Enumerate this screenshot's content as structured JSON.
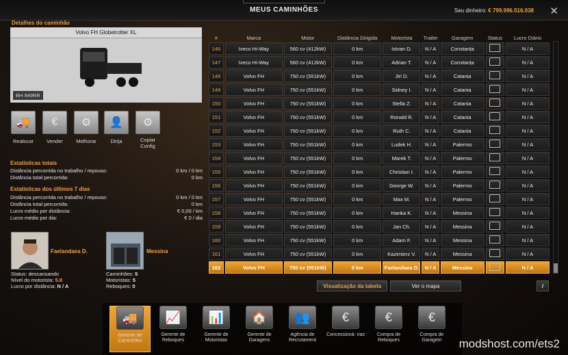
{
  "header": {
    "title": "MEUS CAMINHÕES",
    "money_label": "Seu dinheiro:",
    "money_value": "€ 799.996.516.038",
    "close": "✕"
  },
  "truck": {
    "section_title": "Detalhes do caminhão",
    "name": "Volvo FH Globetrotter XL",
    "plate": "BH 949RR"
  },
  "actions": [
    {
      "label": "Realocar",
      "icon": "truck-relocate-icon"
    },
    {
      "label": "Vender",
      "icon": "sell-truck-icon"
    },
    {
      "label": "Melhorar",
      "icon": "upgrade-truck-icon"
    },
    {
      "label": "Dirija",
      "icon": "drive-icon"
    },
    {
      "label": "Copiar",
      "label2": "Config",
      "icon": "copy-config-icon"
    }
  ],
  "stats_total": {
    "title": "Estatísticas totais",
    "rows": [
      {
        "label": "Distância percorrida no trabalho / repouso:",
        "value": "0 km / 0 km"
      },
      {
        "label": "Distância total percorrida:",
        "value": "0 km"
      }
    ]
  },
  "stats_7days": {
    "title": "Estatísticas dos últimos 7 dias",
    "rows": [
      {
        "label": "Distância percorrida no trabalho / repouso:",
        "value": "0 km / 0 km"
      },
      {
        "label": "Distância total percorrida:",
        "value": "0 km"
      },
      {
        "label": "Lucro médio por distância:",
        "value": "€ 0,00 / km"
      },
      {
        "label": "Lucro médio por dia:",
        "value": "€ 0 / dia"
      }
    ]
  },
  "driver": {
    "name": "Faelandaea D.",
    "status_label": "Status:",
    "status": "descansando",
    "level_label": "Nível do motorista:",
    "level": "5.8",
    "profit_label": "Lucro por distância:",
    "profit": "N / A"
  },
  "garage": {
    "name": "Messina",
    "trucks_label": "Caminhões:",
    "trucks": "5",
    "drivers_label": "Motoristas:",
    "drivers": "5",
    "trailers_label": "Reboques:",
    "trailers": "0"
  },
  "table": {
    "headers": [
      "#",
      "Marca",
      "Motor",
      "Distância Dirigida",
      "Motorista",
      "Trailer",
      "Garagem",
      "Status",
      "Lucro Diário"
    ],
    "rows": [
      [
        "146",
        "Iveco Hi-Way",
        "560 cv (412kW)",
        "0 km",
        "Istvan D.",
        "N / A",
        "Constanța",
        "N / A"
      ],
      [
        "147",
        "Iveco Hi-Way",
        "560 cv (412kW)",
        "0 km",
        "Adrian T.",
        "N / A",
        "Constanța",
        "N / A"
      ],
      [
        "148",
        "Volvo FH",
        "750 cv (551kW)",
        "0 km",
        "Jiri D.",
        "N / A",
        "Catania",
        "N / A"
      ],
      [
        "149",
        "Volvo FH",
        "750 cv (551kW)",
        "0 km",
        "Sidney I.",
        "N / A",
        "Catania",
        "N / A"
      ],
      [
        "150",
        "Volvo FH",
        "750 cv (551kW)",
        "0 km",
        "Stella Z.",
        "N / A",
        "Catania",
        "N / A"
      ],
      [
        "151",
        "Volvo FH",
        "750 cv (551kW)",
        "0 km",
        "Ronald R.",
        "N / A",
        "Catania",
        "N / A"
      ],
      [
        "152",
        "Volvo FH",
        "750 cv (551kW)",
        "0 km",
        "Ruth C.",
        "N / A",
        "Catania",
        "N / A"
      ],
      [
        "153",
        "Volvo FH",
        "750 cv (551kW)",
        "0 km",
        "Ludek H.",
        "N / A",
        "Palermo",
        "N / A"
      ],
      [
        "154",
        "Volvo FH",
        "750 cv (551kW)",
        "0 km",
        "Marek T.",
        "N / A",
        "Palermo",
        "N / A"
      ],
      [
        "155",
        "Volvo FH",
        "750 cv (551kW)",
        "0 km",
        "Christian I.",
        "N / A",
        "Palermo",
        "N / A"
      ],
      [
        "156",
        "Volvo FH",
        "750 cv (551kW)",
        "0 km",
        "George W.",
        "N / A",
        "Palermo",
        "N / A"
      ],
      [
        "157",
        "Volvo FH",
        "750 cv (551kW)",
        "0 km",
        "Max M.",
        "N / A",
        "Palermo",
        "N / A"
      ],
      [
        "158",
        "Volvo FH",
        "750 cv (551kW)",
        "0 km",
        "Hanka K.",
        "N / A",
        "Messina",
        "N / A"
      ],
      [
        "159",
        "Volvo FH",
        "750 cv (551kW)",
        "0 km",
        "Jan Ch.",
        "N / A",
        "Messina",
        "N / A"
      ],
      [
        "160",
        "Volvo FH",
        "750 cv (551kW)",
        "0 km",
        "Adam F.",
        "N / A",
        "Messina",
        "N / A"
      ],
      [
        "161",
        "Volvo FH",
        "750 cv (551kW)",
        "0 km",
        "Kazimierz V.",
        "N / A",
        "Messina",
        "N / A"
      ],
      [
        "162",
        "Volvo FH",
        "750 cv (551kW)",
        "0 km",
        "Faelandaea D.",
        "N / A",
        "Messina",
        "N / A"
      ]
    ]
  },
  "view_buttons": {
    "table": "Visualização da tabela",
    "map": "Ver o mapa",
    "info": "i"
  },
  "dock": [
    {
      "label": "Gerente de Caminhões",
      "icon": "truck-manager-icon"
    },
    {
      "label": "Gerente de Reboques",
      "icon": "trailer-manager-icon"
    },
    {
      "label": "Gerente de Motoristas",
      "icon": "driver-manager-icon"
    },
    {
      "label": "Gerente de Garagens",
      "icon": "garage-manager-icon"
    },
    {
      "label": "Agência de Recrutament",
      "icon": "recruitment-icon"
    },
    {
      "label": "Concessioná- rias",
      "icon": "dealer-icon"
    },
    {
      "label": "Compra de Reboques",
      "icon": "buy-trailer-icon"
    },
    {
      "label": "Compra de Garagem",
      "icon": "buy-garage-icon"
    }
  ],
  "watermark": "modshost.com/ets2",
  "colors": {
    "accent": "#f2a23a"
  }
}
